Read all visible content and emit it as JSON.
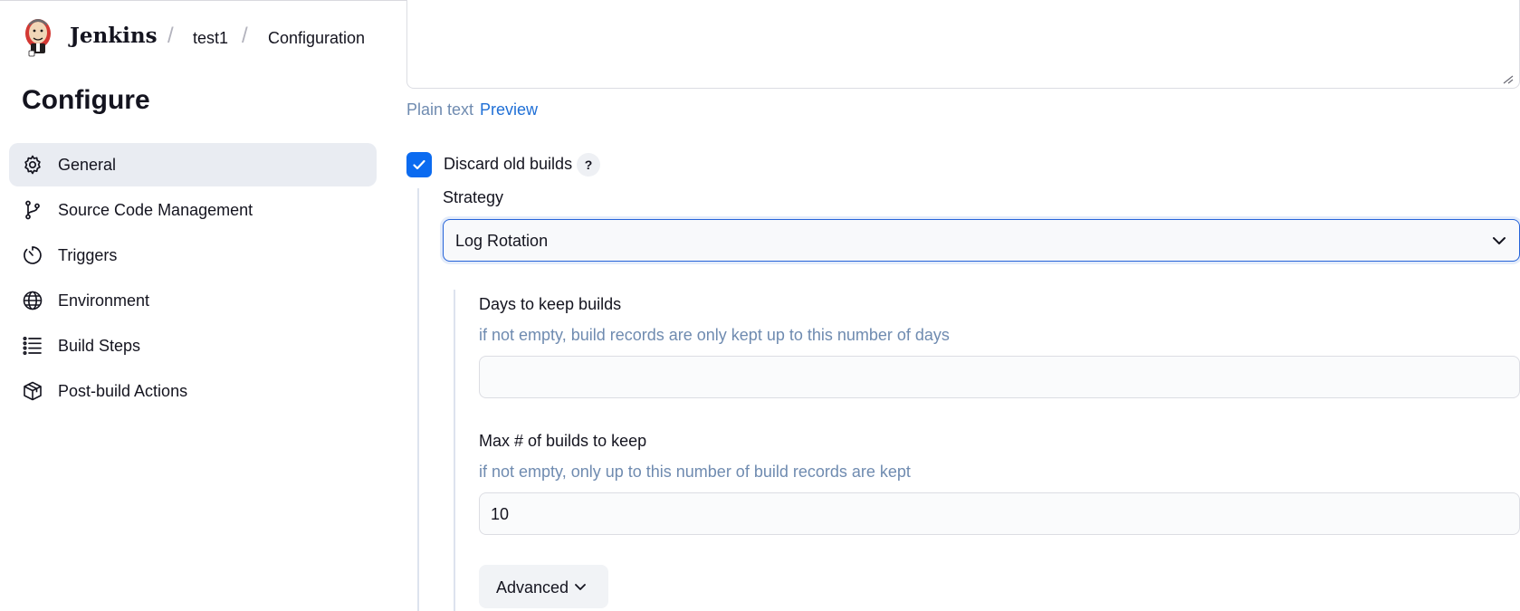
{
  "header": {
    "brand": "Jenkins",
    "breadcrumbs": [
      "test1",
      "Configuration"
    ],
    "separator": "/"
  },
  "sidebar": {
    "title": "Configure",
    "items": [
      {
        "label": "General",
        "icon": "gear-icon",
        "active": true
      },
      {
        "label": "Source Code Management",
        "icon": "branch-icon",
        "active": false
      },
      {
        "label": "Triggers",
        "icon": "timer-icon",
        "active": false
      },
      {
        "label": "Environment",
        "icon": "globe-icon",
        "active": false
      },
      {
        "label": "Build Steps",
        "icon": "list-icon",
        "active": false
      },
      {
        "label": "Post-build Actions",
        "icon": "package-icon",
        "active": false
      }
    ]
  },
  "description": {
    "plain_text_label": "Plain text",
    "preview_label": "Preview"
  },
  "discard": {
    "checkbox_label": "Discard old builds",
    "checked": true,
    "help_label": "?",
    "strategy_label": "Strategy",
    "strategy_value": "Log Rotation",
    "days": {
      "label": "Days to keep builds",
      "help": "if not empty, build records are only kept up to this number of days",
      "value": ""
    },
    "max_builds": {
      "label": "Max # of builds to keep",
      "help": "if not empty, only up to this number of build records are kept",
      "value": "10"
    },
    "advanced_label": "Advanced"
  },
  "colors": {
    "accent": "#0b6bf0",
    "link": "#1f6fd6",
    "help_text": "#6f8bb0",
    "sidebar_active_bg": "#e9ecf2"
  }
}
